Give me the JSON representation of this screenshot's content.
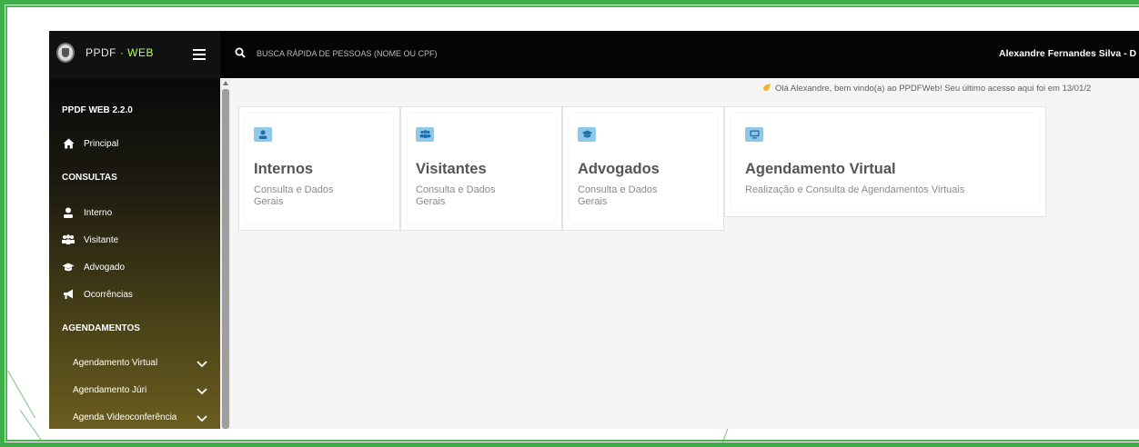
{
  "brand": {
    "part1": "PPDF",
    "part2": " · WEB"
  },
  "search": {
    "placeholder": "BUSCA RÁPIDA DE PESSOAS (NOME OU CPF)"
  },
  "user": {
    "name": "Alexandre Fernandes Silva - D"
  },
  "sidebar": {
    "version": "PPDF WEB 2.2.0",
    "principal": "Principal",
    "consultas_heading": "CONSULTAS",
    "consultas": [
      {
        "label": "Interno",
        "icon": "user-icon"
      },
      {
        "label": "Visitante",
        "icon": "users-icon"
      },
      {
        "label": "Advogado",
        "icon": "graduation-cap-icon"
      },
      {
        "label": "Ocorrências",
        "icon": "megaphone-icon"
      }
    ],
    "agendamentos_heading": "AGENDAMENTOS",
    "agendamentos": [
      {
        "label": "Agendamento Virtual"
      },
      {
        "label": "Agendamento Júri"
      },
      {
        "label": "Agenda Videoconferência"
      }
    ]
  },
  "welcome": {
    "text": "Olá Alexandre, bem vindo(a) ao PPDFWeb! Seu último acesso aqui foi em 13/01/2"
  },
  "cards": [
    {
      "title": "Internos",
      "sub1": "Consulta e Dados",
      "sub2": "Gerais",
      "icon": "user-icon"
    },
    {
      "title": "Visitantes",
      "sub1": "Consulta e Dados",
      "sub2": "Gerais",
      "icon": "users-icon"
    },
    {
      "title": "Advogados",
      "sub1": "Consulta e Dados",
      "sub2": "Gerais",
      "icon": "graduation-cap-icon"
    },
    {
      "title": "Agendamento Virtual",
      "sub1": "Realização e Consulta de Agendamentos Virtuais",
      "sub2": "",
      "icon": "monitor-icon"
    }
  ],
  "colors": {
    "frame_green": "#3fae49",
    "topbar": "#050505",
    "brand_accent": "#b2ff59",
    "card_icon_bg": "#90c8e8",
    "card_icon_fg": "#1f6fa8"
  }
}
